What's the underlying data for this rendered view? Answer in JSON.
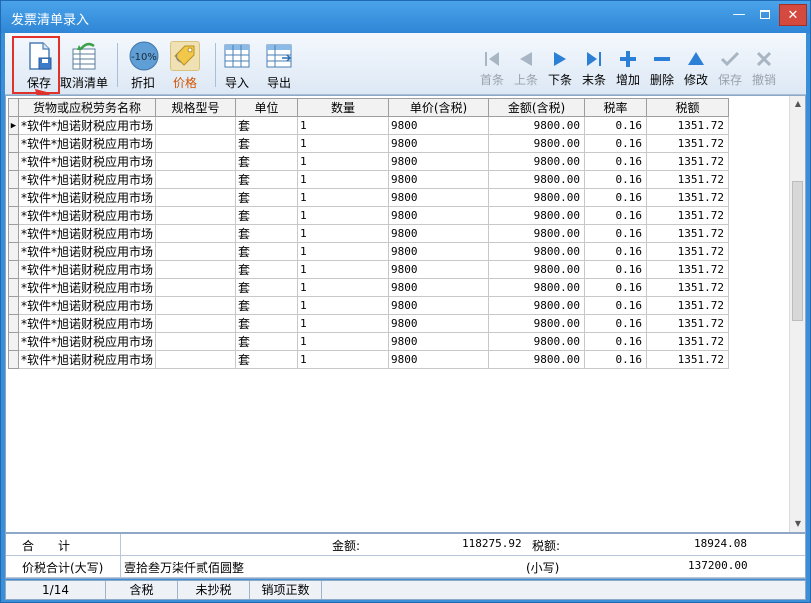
{
  "window": {
    "title": "发票清单录入"
  },
  "toolbar": {
    "save": "保存",
    "cancel_list": "取消清单",
    "discount": "折扣",
    "discount_badge": "-10%",
    "price": "价格",
    "import": "导入",
    "export": "导出"
  },
  "nav": {
    "first": "首条",
    "prev": "上条",
    "next": "下条",
    "last": "末条",
    "add": "增加",
    "delete": "删除",
    "edit": "修改",
    "save": "保存",
    "undo": "撤销"
  },
  "table": {
    "headers": [
      "货物或应税劳务名称",
      "规格型号",
      "单位",
      "数量",
      "单价(含税)",
      "金额(含税)",
      "税率",
      "税额"
    ],
    "rows": [
      {
        "name": "*软件*旭诺财税应用市场",
        "spec": "",
        "unit": "套",
        "qty": "1",
        "price": "9800",
        "amount": "9800.00",
        "rate": "0.16",
        "tax": "1351.72"
      },
      {
        "name": "*软件*旭诺财税应用市场",
        "spec": "",
        "unit": "套",
        "qty": "1",
        "price": "9800",
        "amount": "9800.00",
        "rate": "0.16",
        "tax": "1351.72"
      },
      {
        "name": "*软件*旭诺财税应用市场",
        "spec": "",
        "unit": "套",
        "qty": "1",
        "price": "9800",
        "amount": "9800.00",
        "rate": "0.16",
        "tax": "1351.72"
      },
      {
        "name": "*软件*旭诺财税应用市场",
        "spec": "",
        "unit": "套",
        "qty": "1",
        "price": "9800",
        "amount": "9800.00",
        "rate": "0.16",
        "tax": "1351.72"
      },
      {
        "name": "*软件*旭诺财税应用市场",
        "spec": "",
        "unit": "套",
        "qty": "1",
        "price": "9800",
        "amount": "9800.00",
        "rate": "0.16",
        "tax": "1351.72"
      },
      {
        "name": "*软件*旭诺财税应用市场",
        "spec": "",
        "unit": "套",
        "qty": "1",
        "price": "9800",
        "amount": "9800.00",
        "rate": "0.16",
        "tax": "1351.72"
      },
      {
        "name": "*软件*旭诺财税应用市场",
        "spec": "",
        "unit": "套",
        "qty": "1",
        "price": "9800",
        "amount": "9800.00",
        "rate": "0.16",
        "tax": "1351.72"
      },
      {
        "name": "*软件*旭诺财税应用市场",
        "spec": "",
        "unit": "套",
        "qty": "1",
        "price": "9800",
        "amount": "9800.00",
        "rate": "0.16",
        "tax": "1351.72"
      },
      {
        "name": "*软件*旭诺财税应用市场",
        "spec": "",
        "unit": "套",
        "qty": "1",
        "price": "9800",
        "amount": "9800.00",
        "rate": "0.16",
        "tax": "1351.72"
      },
      {
        "name": "*软件*旭诺财税应用市场",
        "spec": "",
        "unit": "套",
        "qty": "1",
        "price": "9800",
        "amount": "9800.00",
        "rate": "0.16",
        "tax": "1351.72"
      },
      {
        "name": "*软件*旭诺财税应用市场",
        "spec": "",
        "unit": "套",
        "qty": "1",
        "price": "9800",
        "amount": "9800.00",
        "rate": "0.16",
        "tax": "1351.72"
      },
      {
        "name": "*软件*旭诺财税应用市场",
        "spec": "",
        "unit": "套",
        "qty": "1",
        "price": "9800",
        "amount": "9800.00",
        "rate": "0.16",
        "tax": "1351.72"
      },
      {
        "name": "*软件*旭诺财税应用市场",
        "spec": "",
        "unit": "套",
        "qty": "1",
        "price": "9800",
        "amount": "9800.00",
        "rate": "0.16",
        "tax": "1351.72"
      },
      {
        "name": "*软件*旭诺财税应用市场",
        "spec": "",
        "unit": "套",
        "qty": "1",
        "price": "9800",
        "amount": "9800.00",
        "rate": "0.16",
        "tax": "1351.72"
      }
    ]
  },
  "footer": {
    "total_label": "合　　计",
    "amount_label": "金额:",
    "amount_value": "118275.92",
    "tax_label": "税额:",
    "tax_value": "18924.08",
    "grand_label": "价税合计(大写)",
    "grand_upper": "壹拾叁万柒仟贰佰圆整",
    "lower_label": "(小写)",
    "grand_lower": "137200.00"
  },
  "status": {
    "page": "1/14",
    "tax_mode": "含税",
    "copy_state": "未抄税",
    "invoice_type": "销项正数"
  },
  "colors": {
    "titlebar": "#3a8fd8",
    "highlight": "#e0322a",
    "price_label": "#d35400"
  }
}
